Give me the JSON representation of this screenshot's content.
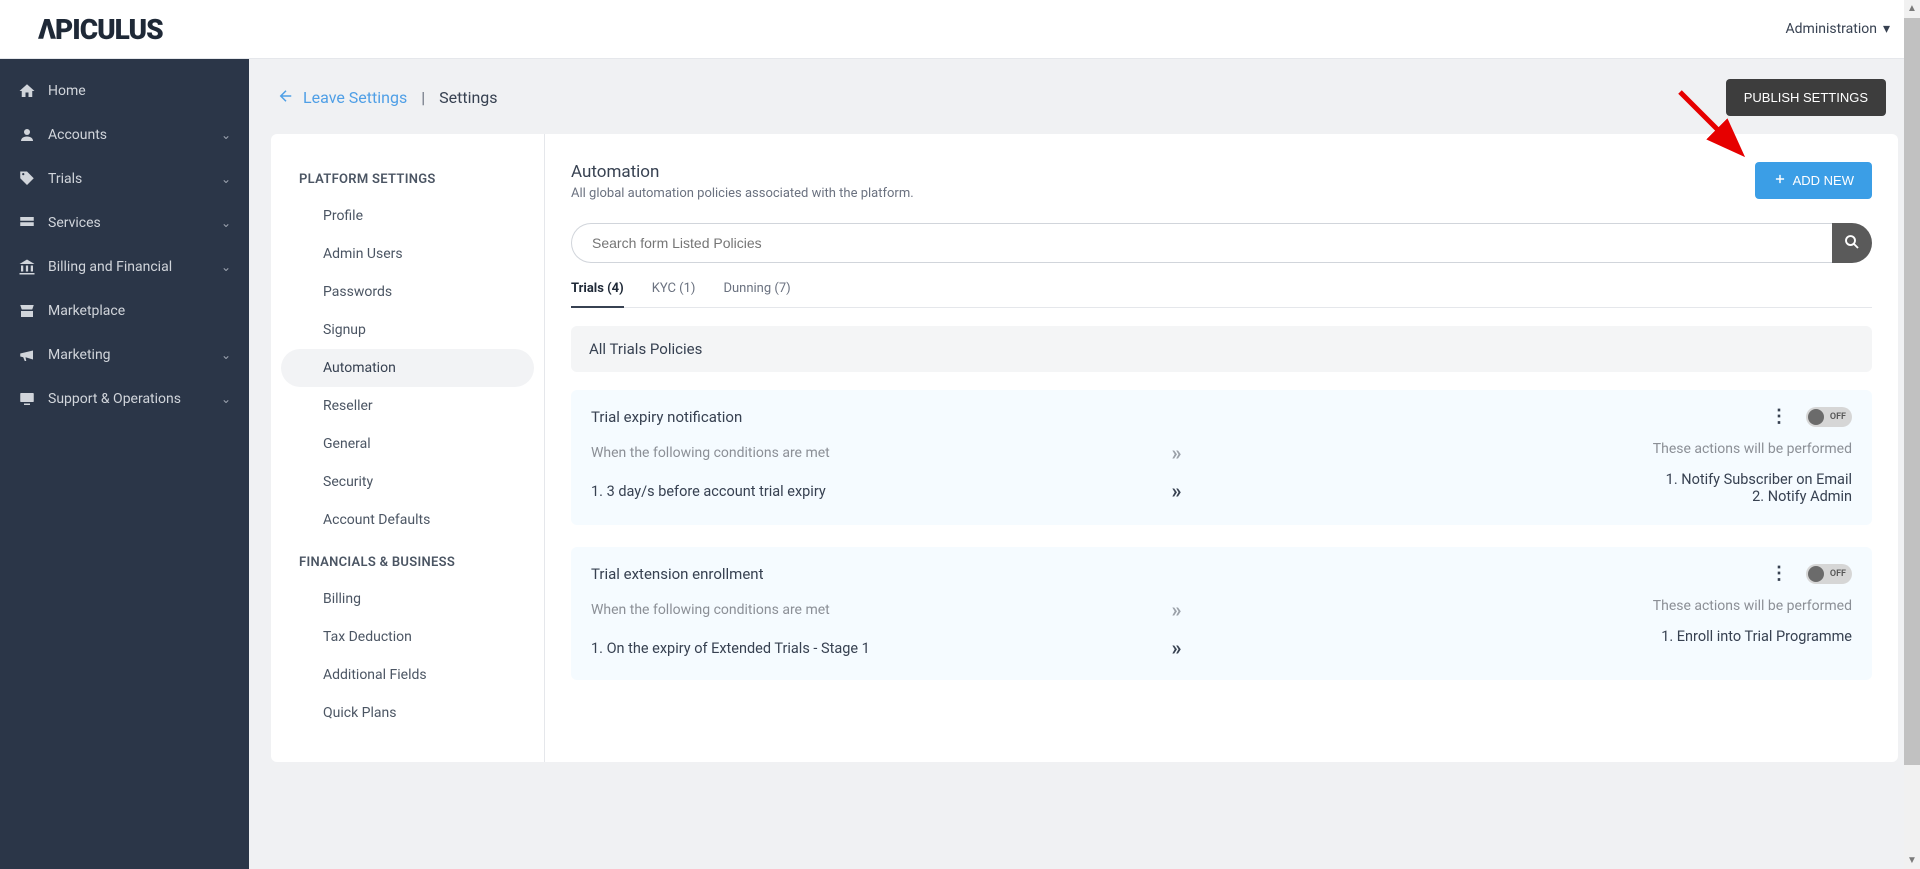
{
  "logo": "ΛPICULUS",
  "header": {
    "admin_label": "Administration"
  },
  "sidebar": {
    "items": [
      {
        "label": "Home",
        "icon": "home",
        "expandable": false
      },
      {
        "label": "Accounts",
        "icon": "user",
        "expandable": true
      },
      {
        "label": "Trials",
        "icon": "tag",
        "expandable": true
      },
      {
        "label": "Services",
        "icon": "layers",
        "expandable": true
      },
      {
        "label": "Billing and Financial",
        "icon": "bank",
        "expandable": true
      },
      {
        "label": "Marketplace",
        "icon": "store",
        "expandable": false
      },
      {
        "label": "Marketing",
        "icon": "megaphone",
        "expandable": true
      },
      {
        "label": "Support & Operations",
        "icon": "monitor",
        "expandable": true
      }
    ]
  },
  "breadcrumb": {
    "back_label": "Leave Settings",
    "current": "Settings"
  },
  "actions": {
    "publish": "PUBLISH SETTINGS",
    "add_new": "ADD NEW"
  },
  "settings_nav": {
    "groups": [
      {
        "heading": "PLATFORM SETTINGS",
        "items": [
          "Profile",
          "Admin Users",
          "Passwords",
          "Signup",
          "Automation",
          "Reseller",
          "General",
          "Security",
          "Account Defaults"
        ]
      },
      {
        "heading": "FINANCIALS & BUSINESS",
        "items": [
          "Billing",
          "Tax Deduction",
          "Additional Fields",
          "Quick Plans"
        ]
      }
    ],
    "active": "Automation"
  },
  "panel": {
    "title": "Automation",
    "subtitle": "All global automation policies associated with the platform."
  },
  "search": {
    "placeholder": "Search form Listed Policies"
  },
  "tabs": [
    {
      "label": "Trials (4)",
      "active": true
    },
    {
      "label": "KYC (1)",
      "active": false
    },
    {
      "label": "Dunning (7)",
      "active": false
    }
  ],
  "section_heading": "All Trials Policies",
  "labels": {
    "conditions": "When the following conditions are met",
    "actions": "These actions will be performed",
    "toggle_off": "OFF"
  },
  "policies": [
    {
      "title": "Trial expiry notification",
      "conditions": [
        "1. 3 day/s before account trial expiry"
      ],
      "actions": [
        "1. Notify Subscriber on Email",
        "2. Notify Admin"
      ]
    },
    {
      "title": "Trial extension enrollment",
      "conditions": [
        "1. On the expiry of Extended Trials - Stage 1"
      ],
      "actions": [
        "1. Enroll into Trial Programme"
      ]
    }
  ]
}
